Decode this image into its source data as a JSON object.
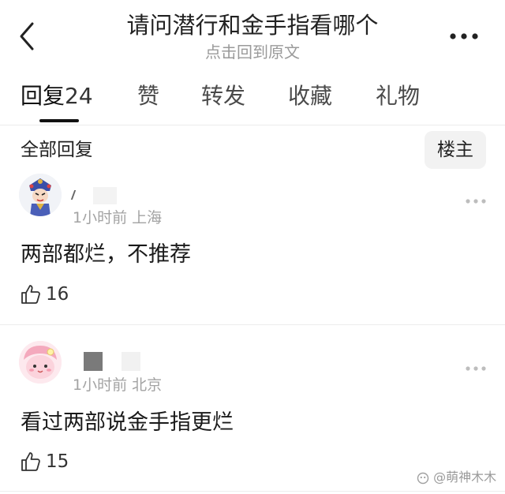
{
  "header": {
    "title": "请问潜行和金手指看哪个",
    "subtitle": "点击回到原文",
    "icons": {
      "back": "chevron-left-icon",
      "more": "more-dots-icon"
    }
  },
  "tabs": [
    {
      "label": "回复",
      "count": "24",
      "active": true
    },
    {
      "label": "赞"
    },
    {
      "label": "转发"
    },
    {
      "label": "收藏"
    },
    {
      "label": "礼物"
    }
  ],
  "section": {
    "title": "全部回复",
    "filter_button": "楼主"
  },
  "comments": [
    {
      "username": "",
      "time": "1小时前",
      "location": "上海",
      "text": "两部都烂，不推荐",
      "likes": "16"
    },
    {
      "username": "",
      "time": "1小时前",
      "location": "北京",
      "text": "看过两部说金手指更烂",
      "likes": "15"
    }
  ],
  "watermark": "@萌神木木",
  "colors": {
    "text": "#1a1a1a",
    "muted": "#a3a3a3",
    "active_underline": "#111111"
  }
}
